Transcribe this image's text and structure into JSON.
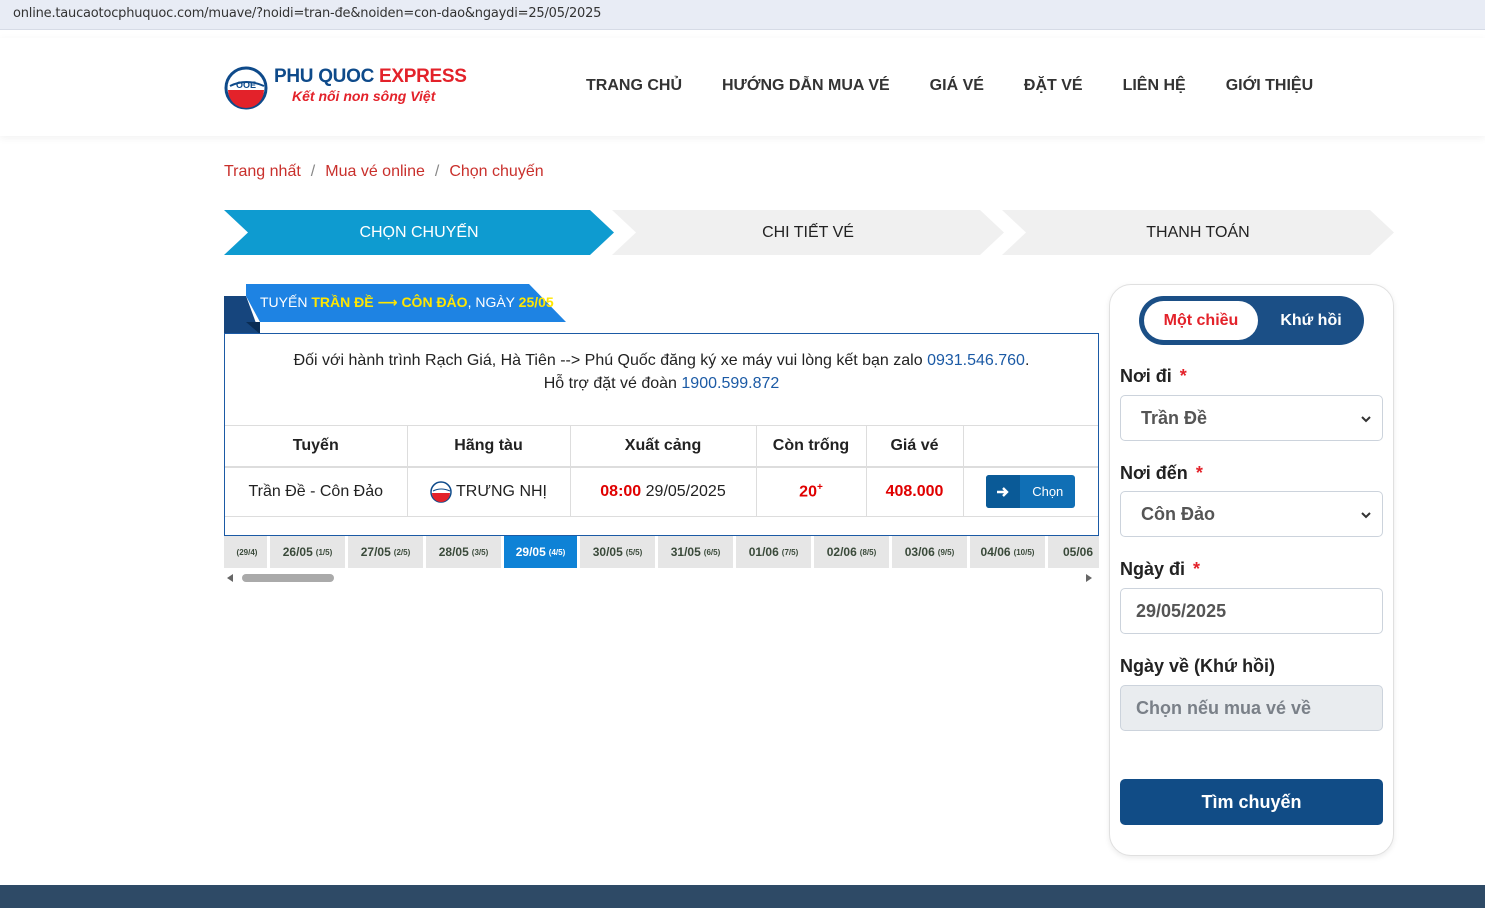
{
  "browser": {
    "url": "online.taucaotocphuquoc.com/muave/?noidi=tran-đe&noiden=con-dao&ngaydi=25/05/2025"
  },
  "logo": {
    "title_a": "PHU QUOC",
    "title_b": "EXPRESS",
    "tagline": "Kết nối non sông Việt",
    "mark_text": "OOE"
  },
  "nav": [
    "TRANG CHỦ",
    "HƯỚNG DẪN MUA VÉ",
    "GIÁ VÉ",
    "ĐẶT VÉ",
    "LIÊN HỆ",
    "GIỚI THIỆU"
  ],
  "breadcrumb": [
    "Trang nhất",
    "Mua vé online",
    "Chọn chuyến"
  ],
  "steps": [
    "CHỌN CHUYẾN",
    "CHI TIẾT VÉ",
    "THANH TOÁN"
  ],
  "route_tab": {
    "prefix": "TUYẾN",
    "from": "TRẦN ĐỀ",
    "arrow": "⟶",
    "to": "CÔN ĐẢO",
    "date_prefix": ", NGÀY",
    "date": "25/05"
  },
  "notice": {
    "line1": "Đối với hành trình Rạch Giá, Hà Tiên --> Phú Quốc đăng ký xe máy vui lòng kết bạn zalo",
    "zalo": "0931.546.760",
    "dot": ".",
    "line2": "Hỗ trợ đặt vé đoàn",
    "hotline": "1900.599.872"
  },
  "table": {
    "headers": [
      "Tuyến",
      "Hãng tàu",
      "Xuất cảng",
      "Còn trống",
      "Giá vé",
      ""
    ],
    "row": {
      "route": "Trần Đề - Côn Đảo",
      "ship": "TRƯNG NHỊ",
      "time": "08:00",
      "date": "29/05/2025",
      "seats": "20",
      "seats_sup": "+",
      "price": "408.000",
      "button": "Chọn"
    }
  },
  "dates": [
    {
      "d": "",
      "s": "(29/4)"
    },
    {
      "d": "26/05",
      "s": "(1/5)"
    },
    {
      "d": "27/05",
      "s": "(2/5)"
    },
    {
      "d": "28/05",
      "s": "(3/5)"
    },
    {
      "d": "29/05",
      "s": "(4/5)",
      "active": true
    },
    {
      "d": "30/05",
      "s": "(5/5)"
    },
    {
      "d": "31/05",
      "s": "(6/5)"
    },
    {
      "d": "01/06",
      "s": "(7/5)"
    },
    {
      "d": "02/06",
      "s": "(8/5)"
    },
    {
      "d": "03/06",
      "s": "(9/5)"
    },
    {
      "d": "04/06",
      "s": "(10/5)"
    },
    {
      "d": "05/06",
      "s": ""
    }
  ],
  "sidebar": {
    "mode_on": "Một chiều",
    "mode_off": "Khứ hồi",
    "from_label": "Nơi đi",
    "from_value": "Trần Đề",
    "to_label": "Nơi đến",
    "to_value": "Côn Đảo",
    "date_label": "Ngày đi",
    "date_value": "29/05/2025",
    "return_label": "Ngày về (Khứ hồi)",
    "return_placeholder": "Chọn nếu mua vé về",
    "required_mark": "*",
    "search_button": "Tìm chuyến"
  },
  "colors": {
    "primary": "#114c86",
    "accent_red": "#e3222a",
    "step_active": "#0e9bd0",
    "date_active": "#0e82d6"
  }
}
